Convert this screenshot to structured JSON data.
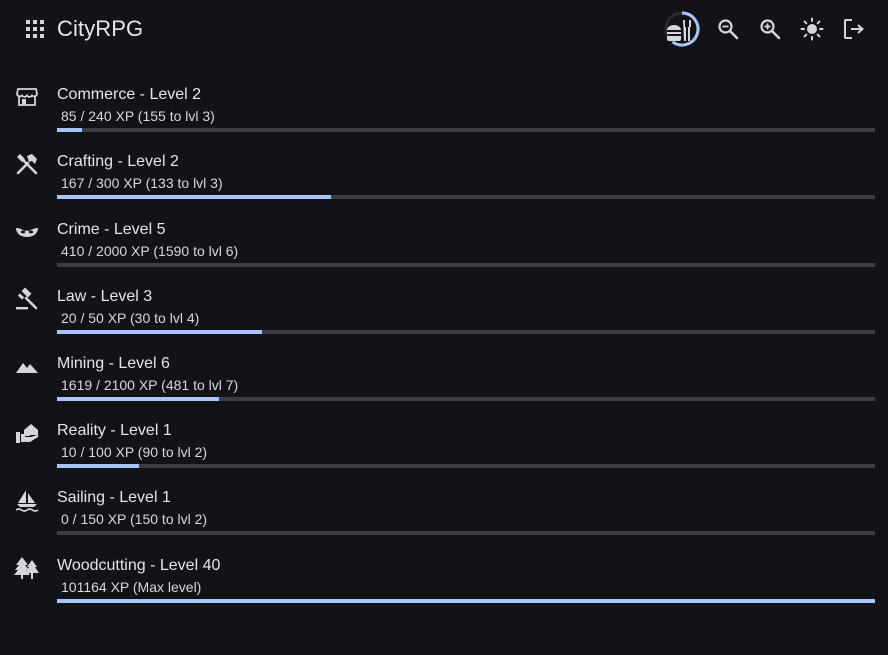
{
  "app": {
    "title": "CityRPG"
  },
  "toolbar": {
    "icons": [
      "apps-icon",
      "food-icon",
      "zoom-out-icon",
      "zoom-in-icon",
      "brightness-icon",
      "logout-icon"
    ],
    "food_ring_progress": 0.6,
    "accent": "#a9c5ff"
  },
  "skills": [
    {
      "name": "Commerce - Level 2",
      "xp": "85 / 240 XP (155 to lvl 3)",
      "progress": 0.03,
      "icon": "store-icon"
    },
    {
      "name": "Crafting - Level 2",
      "xp": "167 / 300 XP (133 to lvl 3)",
      "progress": 0.335,
      "icon": "tools-icon"
    },
    {
      "name": "Crime - Level 5",
      "xp": "410 / 2000 XP (1590 to lvl 6)",
      "progress": 0.0,
      "icon": "mask-icon"
    },
    {
      "name": "Law - Level 3",
      "xp": "20 / 50 XP (30 to lvl 4)",
      "progress": 0.25,
      "icon": "gavel-icon"
    },
    {
      "name": "Mining - Level 6",
      "xp": "1619 / 2100 XP (481 to lvl 7)",
      "progress": 0.198,
      "icon": "mountain-icon"
    },
    {
      "name": "Reality - Level 1",
      "xp": "10 / 100 XP (90 to lvl 2)",
      "progress": 0.1,
      "icon": "house-hand-icon"
    },
    {
      "name": "Sailing - Level 1",
      "xp": "0 / 150 XP (150 to lvl 2)",
      "progress": 0.0,
      "icon": "sailboat-icon"
    },
    {
      "name": "Woodcutting - Level 40",
      "xp": "101164 XP (Max level)",
      "progress": 1.0,
      "icon": "trees-icon"
    }
  ]
}
